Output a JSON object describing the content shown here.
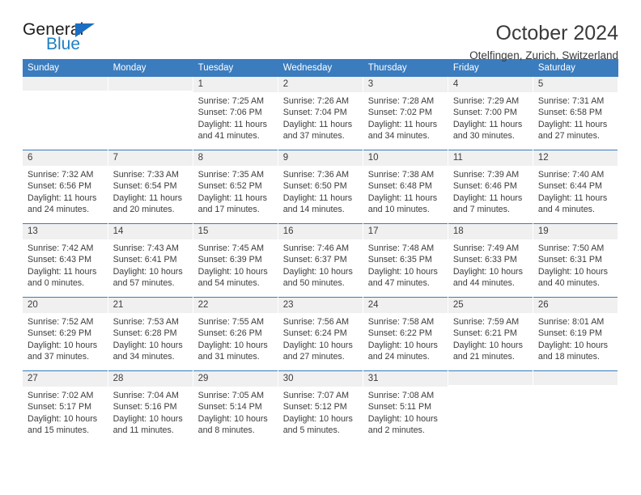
{
  "brand": {
    "name_top": "General",
    "name_bottom": "Blue",
    "accent_color": "#1b6ec2"
  },
  "header": {
    "title": "October 2024",
    "subtitle": "Otelfingen, Zurich, Switzerland"
  },
  "calendar": {
    "header_bg": "#3a7cbe",
    "daynum_bg": "#f0f0f0",
    "weekday_labels": [
      "Sunday",
      "Monday",
      "Tuesday",
      "Wednesday",
      "Thursday",
      "Friday",
      "Saturday"
    ],
    "weeks": [
      [
        {
          "day": "",
          "empty": true
        },
        {
          "day": "",
          "empty": true
        },
        {
          "day": "1",
          "sunrise": "Sunrise: 7:25 AM",
          "sunset": "Sunset: 7:06 PM",
          "daylight": "Daylight: 11 hours and 41 minutes."
        },
        {
          "day": "2",
          "sunrise": "Sunrise: 7:26 AM",
          "sunset": "Sunset: 7:04 PM",
          "daylight": "Daylight: 11 hours and 37 minutes."
        },
        {
          "day": "3",
          "sunrise": "Sunrise: 7:28 AM",
          "sunset": "Sunset: 7:02 PM",
          "daylight": "Daylight: 11 hours and 34 minutes."
        },
        {
          "day": "4",
          "sunrise": "Sunrise: 7:29 AM",
          "sunset": "Sunset: 7:00 PM",
          "daylight": "Daylight: 11 hours and 30 minutes."
        },
        {
          "day": "5",
          "sunrise": "Sunrise: 7:31 AM",
          "sunset": "Sunset: 6:58 PM",
          "daylight": "Daylight: 11 hours and 27 minutes."
        }
      ],
      [
        {
          "day": "6",
          "sunrise": "Sunrise: 7:32 AM",
          "sunset": "Sunset: 6:56 PM",
          "daylight": "Daylight: 11 hours and 24 minutes."
        },
        {
          "day": "7",
          "sunrise": "Sunrise: 7:33 AM",
          "sunset": "Sunset: 6:54 PM",
          "daylight": "Daylight: 11 hours and 20 minutes."
        },
        {
          "day": "8",
          "sunrise": "Sunrise: 7:35 AM",
          "sunset": "Sunset: 6:52 PM",
          "daylight": "Daylight: 11 hours and 17 minutes."
        },
        {
          "day": "9",
          "sunrise": "Sunrise: 7:36 AM",
          "sunset": "Sunset: 6:50 PM",
          "daylight": "Daylight: 11 hours and 14 minutes."
        },
        {
          "day": "10",
          "sunrise": "Sunrise: 7:38 AM",
          "sunset": "Sunset: 6:48 PM",
          "daylight": "Daylight: 11 hours and 10 minutes."
        },
        {
          "day": "11",
          "sunrise": "Sunrise: 7:39 AM",
          "sunset": "Sunset: 6:46 PM",
          "daylight": "Daylight: 11 hours and 7 minutes."
        },
        {
          "day": "12",
          "sunrise": "Sunrise: 7:40 AM",
          "sunset": "Sunset: 6:44 PM",
          "daylight": "Daylight: 11 hours and 4 minutes."
        }
      ],
      [
        {
          "day": "13",
          "sunrise": "Sunrise: 7:42 AM",
          "sunset": "Sunset: 6:43 PM",
          "daylight": "Daylight: 11 hours and 0 minutes."
        },
        {
          "day": "14",
          "sunrise": "Sunrise: 7:43 AM",
          "sunset": "Sunset: 6:41 PM",
          "daylight": "Daylight: 10 hours and 57 minutes."
        },
        {
          "day": "15",
          "sunrise": "Sunrise: 7:45 AM",
          "sunset": "Sunset: 6:39 PM",
          "daylight": "Daylight: 10 hours and 54 minutes."
        },
        {
          "day": "16",
          "sunrise": "Sunrise: 7:46 AM",
          "sunset": "Sunset: 6:37 PM",
          "daylight": "Daylight: 10 hours and 50 minutes."
        },
        {
          "day": "17",
          "sunrise": "Sunrise: 7:48 AM",
          "sunset": "Sunset: 6:35 PM",
          "daylight": "Daylight: 10 hours and 47 minutes."
        },
        {
          "day": "18",
          "sunrise": "Sunrise: 7:49 AM",
          "sunset": "Sunset: 6:33 PM",
          "daylight": "Daylight: 10 hours and 44 minutes."
        },
        {
          "day": "19",
          "sunrise": "Sunrise: 7:50 AM",
          "sunset": "Sunset: 6:31 PM",
          "daylight": "Daylight: 10 hours and 40 minutes."
        }
      ],
      [
        {
          "day": "20",
          "sunrise": "Sunrise: 7:52 AM",
          "sunset": "Sunset: 6:29 PM",
          "daylight": "Daylight: 10 hours and 37 minutes."
        },
        {
          "day": "21",
          "sunrise": "Sunrise: 7:53 AM",
          "sunset": "Sunset: 6:28 PM",
          "daylight": "Daylight: 10 hours and 34 minutes."
        },
        {
          "day": "22",
          "sunrise": "Sunrise: 7:55 AM",
          "sunset": "Sunset: 6:26 PM",
          "daylight": "Daylight: 10 hours and 31 minutes."
        },
        {
          "day": "23",
          "sunrise": "Sunrise: 7:56 AM",
          "sunset": "Sunset: 6:24 PM",
          "daylight": "Daylight: 10 hours and 27 minutes."
        },
        {
          "day": "24",
          "sunrise": "Sunrise: 7:58 AM",
          "sunset": "Sunset: 6:22 PM",
          "daylight": "Daylight: 10 hours and 24 minutes."
        },
        {
          "day": "25",
          "sunrise": "Sunrise: 7:59 AM",
          "sunset": "Sunset: 6:21 PM",
          "daylight": "Daylight: 10 hours and 21 minutes."
        },
        {
          "day": "26",
          "sunrise": "Sunrise: 8:01 AM",
          "sunset": "Sunset: 6:19 PM",
          "daylight": "Daylight: 10 hours and 18 minutes."
        }
      ],
      [
        {
          "day": "27",
          "sunrise": "Sunrise: 7:02 AM",
          "sunset": "Sunset: 5:17 PM",
          "daylight": "Daylight: 10 hours and 15 minutes."
        },
        {
          "day": "28",
          "sunrise": "Sunrise: 7:04 AM",
          "sunset": "Sunset: 5:16 PM",
          "daylight": "Daylight: 10 hours and 11 minutes."
        },
        {
          "day": "29",
          "sunrise": "Sunrise: 7:05 AM",
          "sunset": "Sunset: 5:14 PM",
          "daylight": "Daylight: 10 hours and 8 minutes."
        },
        {
          "day": "30",
          "sunrise": "Sunrise: 7:07 AM",
          "sunset": "Sunset: 5:12 PM",
          "daylight": "Daylight: 10 hours and 5 minutes."
        },
        {
          "day": "31",
          "sunrise": "Sunrise: 7:08 AM",
          "sunset": "Sunset: 5:11 PM",
          "daylight": "Daylight: 10 hours and 2 minutes."
        },
        {
          "day": "",
          "empty": true
        },
        {
          "day": "",
          "empty": true
        }
      ]
    ]
  }
}
